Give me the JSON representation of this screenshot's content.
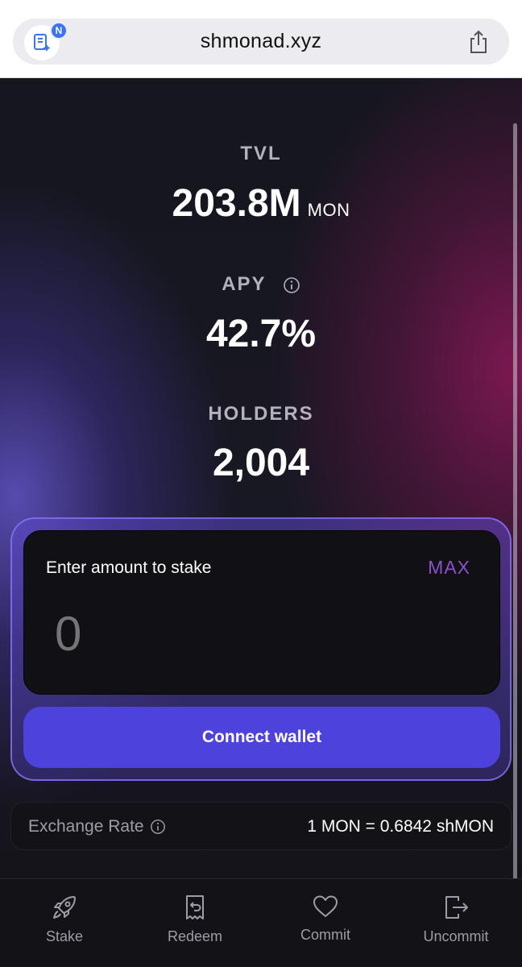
{
  "browser": {
    "url": "shmonad.xyz",
    "extension_badge": "N",
    "icons": [
      "extension-icon",
      "share-icon"
    ]
  },
  "stats": {
    "tvl": {
      "label": "TVL",
      "value": "203.8M",
      "unit": "MON"
    },
    "apy": {
      "label": "APY",
      "value": "42.7%",
      "icon": "info-icon"
    },
    "holders": {
      "label": "HOLDERS",
      "value": "2,004"
    }
  },
  "stake": {
    "label": "Enter amount to stake",
    "max_label": "MAX",
    "amount_placeholder": "0",
    "connect_label": "Connect wallet"
  },
  "exchange": {
    "label": "Exchange Rate",
    "value": "1 MON = 0.6842 shMON"
  },
  "nav": {
    "items": [
      {
        "label": "Stake",
        "icon": "rocket-icon"
      },
      {
        "label": "Redeem",
        "icon": "receipt-icon"
      },
      {
        "label": "Commit",
        "icon": "heart-icon"
      },
      {
        "label": "Uncommit",
        "icon": "exit-icon"
      }
    ]
  },
  "colors": {
    "accent": "#4e42dc",
    "max": "#8c50c8",
    "background": "#15161e"
  }
}
